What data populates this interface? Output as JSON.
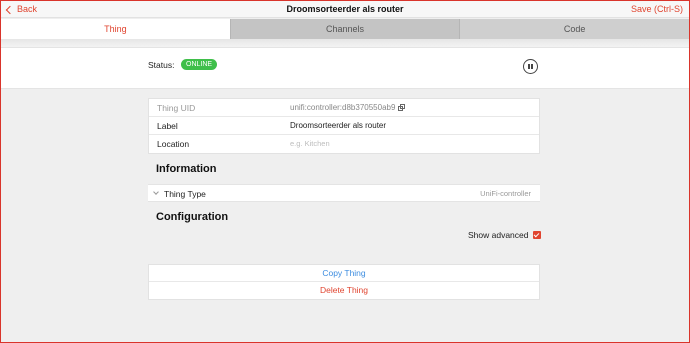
{
  "navbar": {
    "back_label": "Back",
    "title": "Droomsorteerder als router",
    "save_label": "Save (Ctrl-S)"
  },
  "tabs": [
    {
      "label": "Thing",
      "active": true
    },
    {
      "label": "Channels",
      "active": false
    },
    {
      "label": "Code",
      "active": false
    }
  ],
  "status": {
    "label": "Status:",
    "badge": "ONLINE",
    "badge_color": "#3fbf4a",
    "action_icon": "pause-circle-icon"
  },
  "fields": {
    "uid": {
      "label": "Thing UID",
      "value": "unifi:controller:d8b370550ab9"
    },
    "label": {
      "label": "Label",
      "value": "Droomsorteerder als router"
    },
    "location": {
      "label": "Location",
      "placeholder": "e.g. Kitchen"
    }
  },
  "information": {
    "title": "Information",
    "thing_type": {
      "label": "Thing Type",
      "value": "UniFi-controller"
    }
  },
  "configuration": {
    "title": "Configuration",
    "show_advanced_label": "Show advanced",
    "show_advanced_checked": true
  },
  "actions": {
    "copy_label": "Copy Thing",
    "delete_label": "Delete Thing"
  },
  "colors": {
    "accent": "#e0442f",
    "link": "#3d8de0"
  }
}
